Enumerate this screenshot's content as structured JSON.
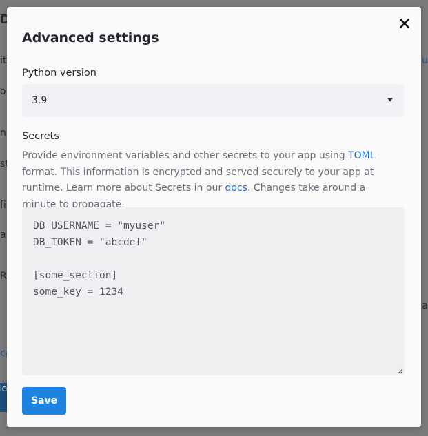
{
  "background": {
    "fragments_left": [
      "D",
      "it",
      "o",
      "n",
      "st",
      "file",
      "a",
      "R",
      "ce",
      "lo"
    ],
    "fragments_right": [
      "lu",
      "a"
    ]
  },
  "modal": {
    "title": "Advanced settings",
    "close_icon": "close-icon"
  },
  "python_version": {
    "label": "Python version",
    "selected": "3.9"
  },
  "secrets": {
    "label": "Secrets",
    "desc_part1": "Provide environment variables and other secrets to your app using ",
    "toml_link": "TOML",
    "desc_part2": " format. This information is encrypted and served securely to your app at runtime. Learn more about Secrets in our ",
    "docs_link": "docs",
    "desc_part3": ". Changes take around a minute to propagate.",
    "value": "DB_USERNAME = \"myuser\"\nDB_TOKEN = \"abcdef\"\n\n[some_section]\nsome_key = 1234"
  },
  "save_button": {
    "label": "Save"
  },
  "colors": {
    "accent": "#1c83e1",
    "link": "#1f6fd1",
    "overlay": "#7b7b7d"
  }
}
